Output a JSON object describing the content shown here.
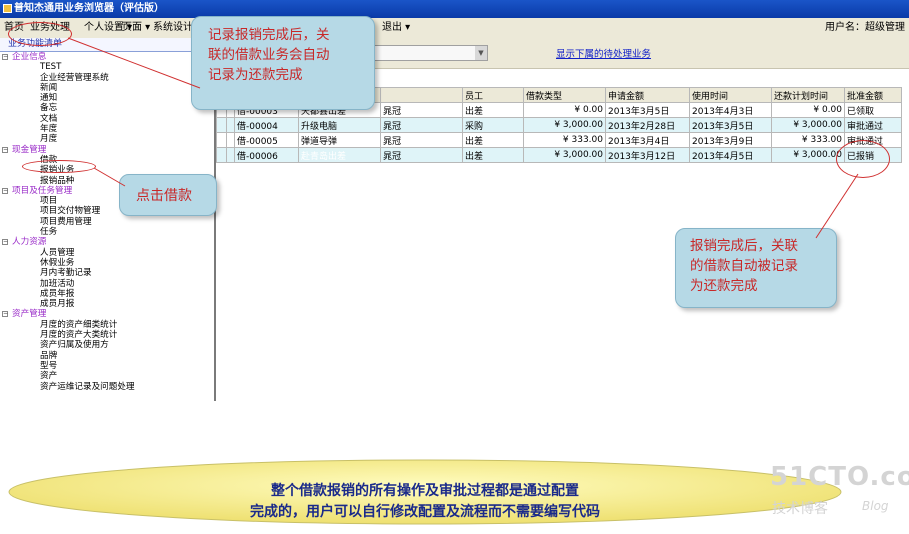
{
  "window": {
    "title": "普知杰通用业务浏览器（评估版）"
  },
  "menu": {
    "items": [
      "首页",
      "业务处理",
      "个人设置 ▾",
      "页面 ▾",
      "系统设计",
      "退出 ▾"
    ],
    "user_label": "用户名：超级管理"
  },
  "sidebar": {
    "header": "业务功能清单",
    "tree": [
      {
        "type": "cat",
        "label": "企业信息"
      },
      {
        "type": "leaf",
        "label": "TEST"
      },
      {
        "type": "leaf",
        "label": "企业经营管理系统"
      },
      {
        "type": "leaf",
        "label": "新闻"
      },
      {
        "type": "leaf",
        "label": "通知"
      },
      {
        "type": "leaf",
        "label": "备忘"
      },
      {
        "type": "leaf",
        "label": "文档"
      },
      {
        "type": "leaf",
        "label": "年度"
      },
      {
        "type": "leaf",
        "label": "月度"
      },
      {
        "type": "cat",
        "label": "现金管理"
      },
      {
        "type": "leaf",
        "label": "借款"
      },
      {
        "type": "leaf",
        "label": "报销业务"
      },
      {
        "type": "leaf",
        "label": "报销品种"
      },
      {
        "type": "cat",
        "label": "项目及任务管理"
      },
      {
        "type": "leaf",
        "label": "项目"
      },
      {
        "type": "leaf",
        "label": "项目交付物管理"
      },
      {
        "type": "leaf",
        "label": "项目费用管理"
      },
      {
        "type": "leaf",
        "label": "任务"
      },
      {
        "type": "cat",
        "label": "人力资源"
      },
      {
        "type": "leaf",
        "label": "人员管理"
      },
      {
        "type": "leaf",
        "label": "休假业务"
      },
      {
        "type": "leaf",
        "label": "月内考勤记录"
      },
      {
        "type": "leaf",
        "label": "加班活动"
      },
      {
        "type": "leaf",
        "label": "成员年报"
      },
      {
        "type": "leaf",
        "label": "成员月报"
      },
      {
        "type": "cat",
        "label": "资产管理"
      },
      {
        "type": "leaf",
        "label": "月度的资产细类统计"
      },
      {
        "type": "leaf",
        "label": "月度的资产大类统计"
      },
      {
        "type": "leaf",
        "label": "资产归属及使用方"
      },
      {
        "type": "leaf",
        "label": "品牌"
      },
      {
        "type": "leaf",
        "label": "型号"
      },
      {
        "type": "leaf",
        "label": "资产"
      },
      {
        "type": "leaf",
        "label": "资产运维记录及问题处理"
      }
    ]
  },
  "main": {
    "pending_link": "显示下属的待处理业务",
    "table": {
      "headers": [
        "",
        "",
        "",
        "员工",
        "借款类型",
        "申请金额",
        "使用时间",
        "还款计划时间",
        "批准金额",
        "当前状态"
      ],
      "rows": [
        [
          "",
          "借-00003",
          "天都县出差",
          "晁冠",
          "出差",
          "¥ 0.00",
          "2013年3月5日",
          "2013年4月3日",
          "¥ 0.00",
          "已领取"
        ],
        [
          "",
          "借-00004",
          "升级电脑",
          "晁冠",
          "采购",
          "¥ 3,000.00",
          "2013年2月28日",
          "2013年3月5日",
          "¥ 3,000.00",
          "审批通过"
        ],
        [
          "",
          "借-00005",
          "弹道导弹",
          "晁冠",
          "出差",
          "¥ 333.00",
          "2013年3月4日",
          "2013年3月9日",
          "¥ 333.00",
          "审批通过"
        ],
        [
          "",
          "借-00006",
          "赴青岛出差",
          "晁冠",
          "出差",
          "¥ 3,000.00",
          "2013年3月12日",
          "2013年4月5日",
          "¥ 3,000.00",
          "已报销"
        ]
      ]
    }
  },
  "callouts": {
    "top": "记录报销完成后，关\n联的借款业务会自动\n记录为还款完成",
    "left": "点击借款",
    "right": "报销完成后，关联\n的借款自动被记录\n为还款完成"
  },
  "banner": {
    "line1": "整个借款报销的所有操作及审批过程都是通过配置",
    "line2": "完成的，用户可以自行修改配置及流程而不需要编写代码"
  },
  "watermark": {
    "main": "51CTO.com",
    "sub": "技术博客",
    "blog": "Blog"
  },
  "colors": {
    "callout_fill": "#b6d9e6",
    "callout_text": "#c82828",
    "banner_fill": "#f4f08a",
    "category": "#9a2cc8"
  }
}
